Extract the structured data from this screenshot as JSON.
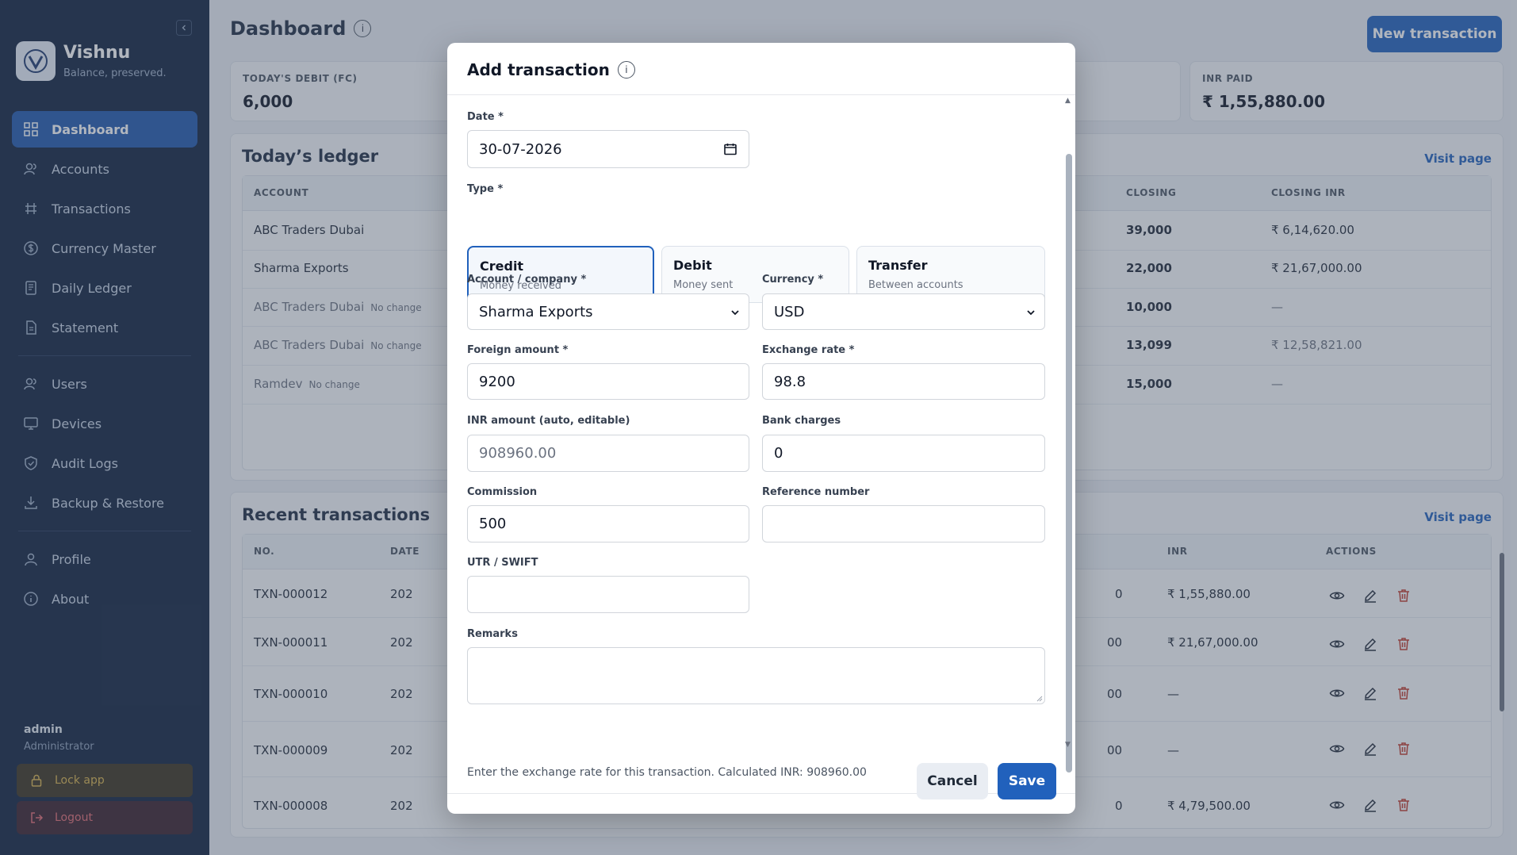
{
  "sidebar": {
    "brand_name": "Vishnu",
    "brand_tagline": "Balance, preserved.",
    "nav": [
      {
        "label": "Dashboard",
        "icon": "grid-icon"
      },
      {
        "label": "Accounts",
        "icon": "users-icon"
      },
      {
        "label": "Transactions",
        "icon": "transfer-icon"
      },
      {
        "label": "Currency Master",
        "icon": "dollar-circle-icon"
      },
      {
        "label": "Daily Ledger",
        "icon": "book-icon"
      },
      {
        "label": "Statement",
        "icon": "file-icon"
      }
    ],
    "nav2": [
      {
        "label": "Users",
        "icon": "users-icon"
      },
      {
        "label": "Devices",
        "icon": "monitor-icon"
      },
      {
        "label": "Audit Logs",
        "icon": "shield-icon"
      },
      {
        "label": "Backup & Restore",
        "icon": "download-icon"
      }
    ],
    "nav3": [
      {
        "label": "Profile",
        "icon": "user-icon"
      },
      {
        "label": "About",
        "icon": "info-icon"
      }
    ],
    "user_name": "admin",
    "user_role": "Administrator",
    "lock_label": "Lock app",
    "logout_label": "Logout"
  },
  "header": {
    "title": "Dashboard",
    "info_glyph": "i",
    "new_button": "New transaction"
  },
  "stats": [
    {
      "label": "TODAY'S DEBIT (FC)",
      "value": "6,000"
    },
    {
      "label": "INR PAID",
      "value": "₹ 1,55,880.00"
    }
  ],
  "ledger": {
    "title": "Today’s ledger",
    "visit": "Visit page",
    "columns": [
      "ACCOUNT",
      "CLOSING",
      "CLOSING INR"
    ],
    "rows": [
      {
        "account": "ABC Traders Dubai",
        "tag": "",
        "closing": "39,000",
        "closing_inr": "₹ 6,14,620.00"
      },
      {
        "account": "Sharma Exports",
        "tag": "",
        "closing": "22,000",
        "closing_inr": "₹ 21,67,000.00"
      },
      {
        "account": "ABC Traders Dubai",
        "tag": "No change",
        "closing": "10,000",
        "closing_inr": "—"
      },
      {
        "account": "ABC Traders Dubai",
        "tag": "No change",
        "closing": "13,099",
        "closing_inr": "₹ 12,58,821.00"
      },
      {
        "account": "Ramdev",
        "tag": "No change",
        "closing": "15,000",
        "closing_inr": "—"
      }
    ]
  },
  "recent": {
    "title": "Recent transactions",
    "visit": "Visit page",
    "columns": [
      "NO.",
      "DATE",
      "INR",
      "ACTIONS"
    ],
    "rows": [
      {
        "no": "TXN-000012",
        "date": "202",
        "amt": "0",
        "inr": "₹ 1,55,880.00"
      },
      {
        "no": "TXN-000011",
        "date": "202",
        "amt": "00",
        "inr": "₹ 21,67,000.00"
      },
      {
        "no": "TXN-000010",
        "date": "202",
        "amt": "00",
        "inr": "—"
      },
      {
        "no": "TXN-000009",
        "date": "202",
        "amt": "00",
        "inr": "—"
      },
      {
        "no": "TXN-000008",
        "date": "202",
        "amt": "0",
        "inr": "₹ 4,79,500.00"
      }
    ]
  },
  "modal": {
    "title": "Add transaction",
    "info_glyph": "i",
    "date_label": "Date *",
    "date_value": "30-07-2026",
    "type_label": "Type *",
    "types": [
      {
        "name": "Credit",
        "sub": "Money received",
        "selected": true
      },
      {
        "name": "Debit",
        "sub": "Money sent",
        "selected": false
      },
      {
        "name": "Transfer",
        "sub": "Between accounts",
        "selected": false
      }
    ],
    "account_label": "Account / company *",
    "account_value": "Sharma Exports",
    "currency_label": "Currency *",
    "currency_value": "USD",
    "foreign_label": "Foreign amount *",
    "foreign_value": "9200",
    "rate_label": "Exchange rate *",
    "rate_value": "98.8",
    "inr_label": "INR amount (auto, editable)",
    "inr_placeholder": "908960.00",
    "bank_label": "Bank charges",
    "bank_value": "0",
    "commission_label": "Commission",
    "commission_value": "500",
    "reference_label": "Reference number",
    "reference_value": "",
    "utr_label": "UTR / SWIFT",
    "utr_value": "",
    "remarks_label": "Remarks",
    "remarks_value": "",
    "hint": "Enter the exchange rate for this transaction. Calculated INR: 908960.00",
    "cancel": "Cancel",
    "save": "Save"
  },
  "colors": {
    "sidebar_bg": "#10223f",
    "accent": "#2161bc",
    "danger": "#c0392b"
  }
}
